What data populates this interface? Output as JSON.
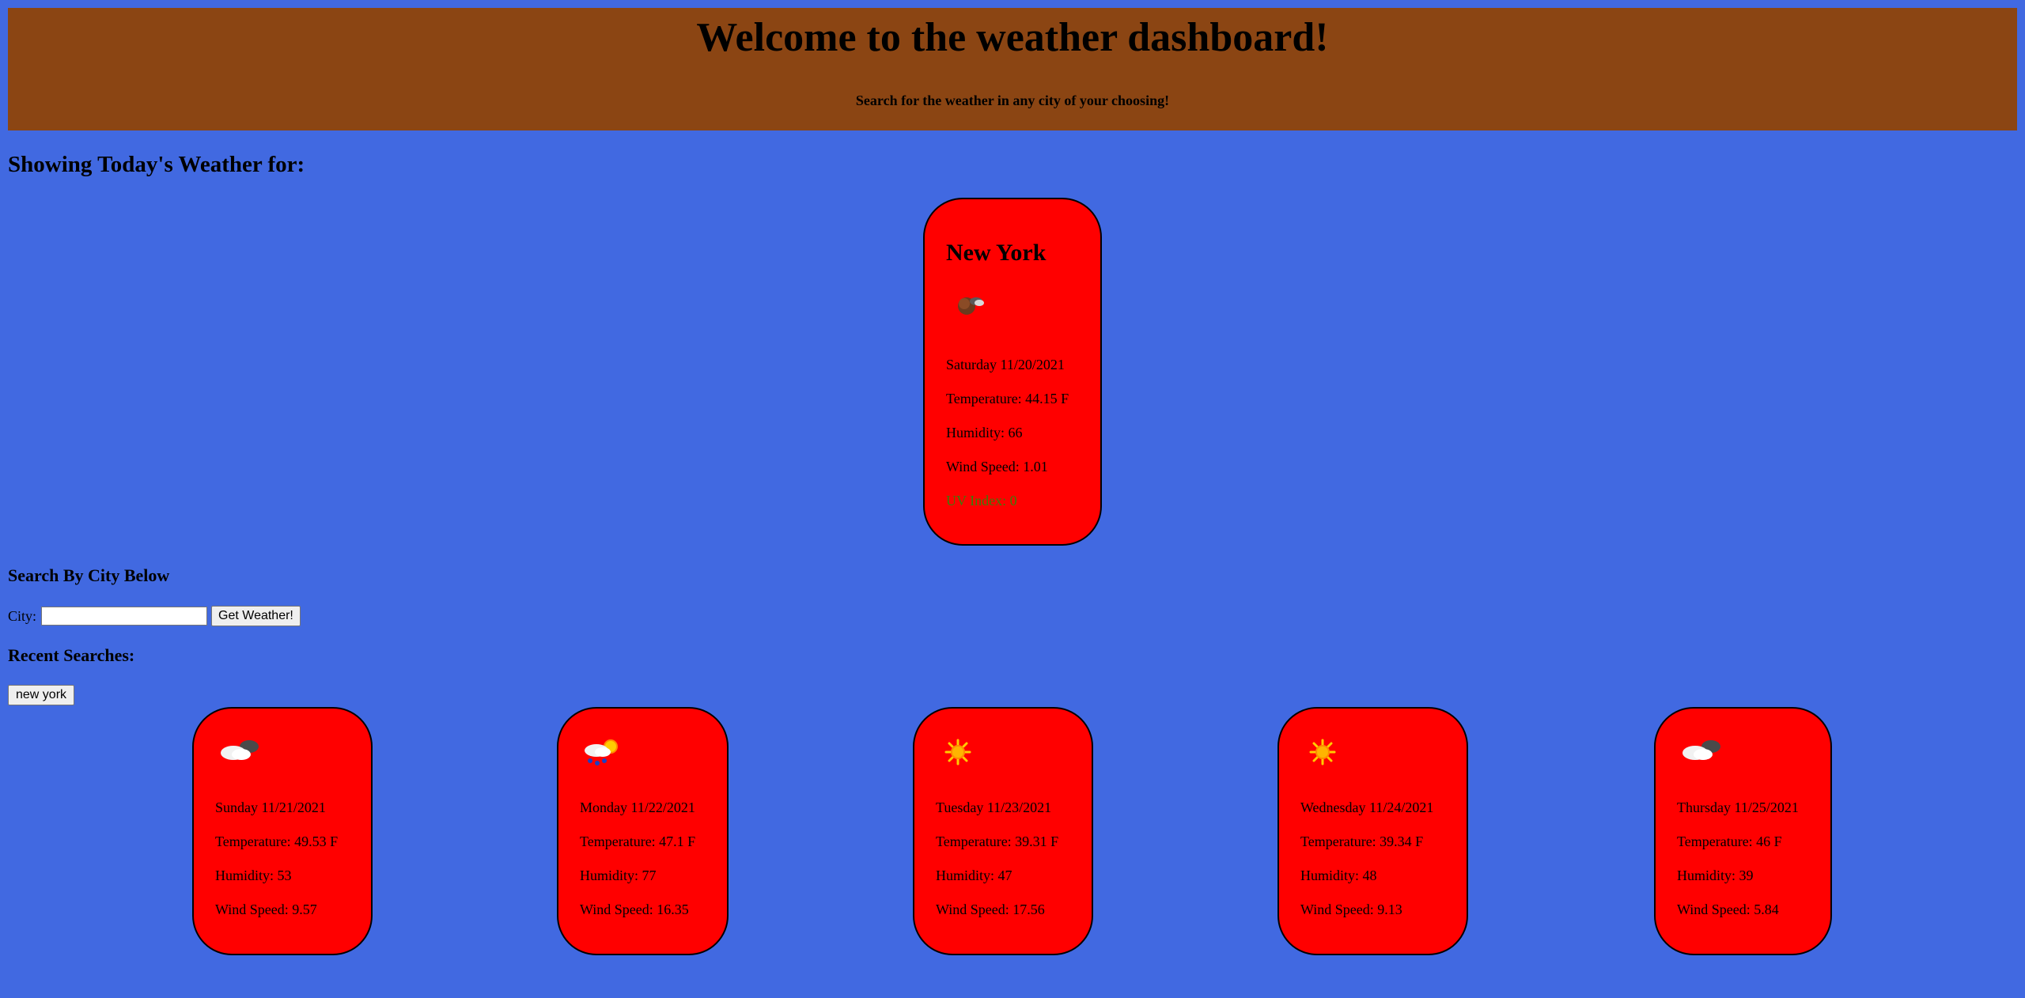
{
  "header": {
    "title": "Welcome to the weather dashboard!",
    "subtitle": "Search for the weather in any city of your choosing!"
  },
  "today_section": {
    "title": "Showing Today's Weather for:"
  },
  "today": {
    "city": "New York",
    "icon": "night-partly-cloudy-icon",
    "date": "Saturday 11/20/2021",
    "temperature": "Temperature: 44.15 F",
    "humidity": "Humidity: 66",
    "wind": "Wind Speed: 1.01",
    "uv": "UV Index: 0",
    "uv_color": "#3a7d0a"
  },
  "search": {
    "title": "Search By City Below",
    "label": "City:",
    "value": "",
    "button_label": "Get Weather!"
  },
  "recent": {
    "title": "Recent Searches:",
    "items": [
      "new york"
    ]
  },
  "forecast": [
    {
      "icon": "cloudy-icon",
      "date": "Sunday 11/21/2021",
      "temperature": "Temperature: 49.53 F",
      "humidity": "Humidity: 53",
      "wind": "Wind Speed: 9.57"
    },
    {
      "icon": "sun-rain-icon",
      "date": "Monday 11/22/2021",
      "temperature": "Temperature: 47.1 F",
      "humidity": "Humidity: 77",
      "wind": "Wind Speed: 16.35"
    },
    {
      "icon": "sun-icon",
      "date": "Tuesday 11/23/2021",
      "temperature": "Temperature: 39.31 F",
      "humidity": "Humidity: 47",
      "wind": "Wind Speed: 17.56"
    },
    {
      "icon": "sun-icon",
      "date": "Wednesday 11/24/2021",
      "temperature": "Temperature: 39.34 F",
      "humidity": "Humidity: 48",
      "wind": "Wind Speed: 9.13"
    },
    {
      "icon": "cloudy-icon",
      "date": "Thursday 11/25/2021",
      "temperature": "Temperature: 46 F",
      "humidity": "Humidity: 39",
      "wind": "Wind Speed: 5.84"
    }
  ],
  "colors": {
    "page_background": "#4169e1",
    "header_background": "#8b4513",
    "card_background": "#ff0000"
  }
}
